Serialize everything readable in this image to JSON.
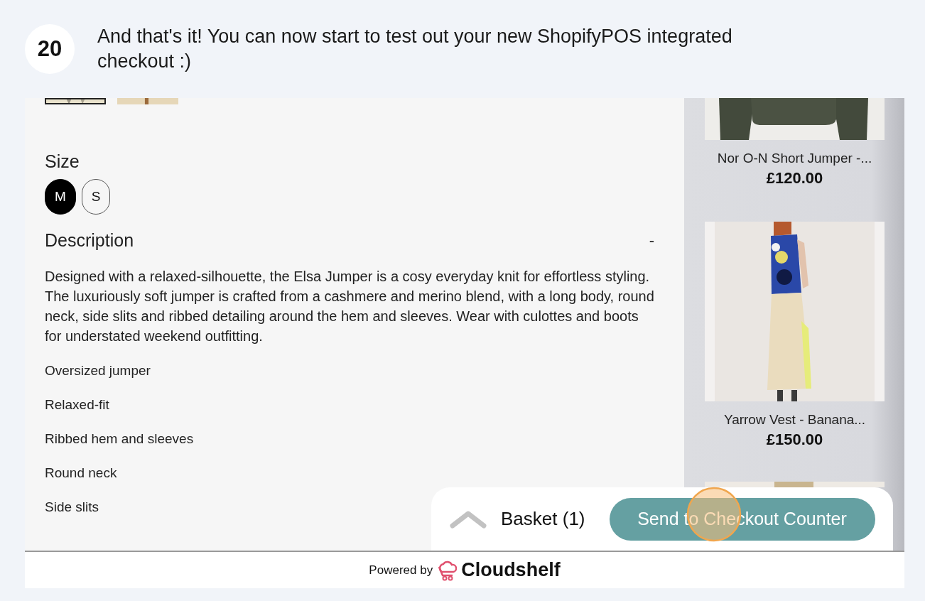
{
  "step": {
    "number": "20",
    "text": "And that's it! You can now start to test out your new ShopifyPOS integrated checkout :)"
  },
  "product": {
    "size_label": "Size",
    "sizes": [
      {
        "label": "M",
        "selected": true
      },
      {
        "label": "S",
        "selected": false
      }
    ],
    "description_title": "Description",
    "description_toggle": "-",
    "description": "Designed with a relaxed-silhouette, the Elsa Jumper is a cosy everyday knit for effortless styling. The luxuriously soft jumper is crafted from a cashmere and merino blend, with a long body, round neck, side slits and ribbed detailing around the hem and sleeves. Wear with culottes and boots for understated weekend outfitting.",
    "features": [
      "Oversized jumper",
      "Relaxed-fit",
      "Ribbed hem and sleeves",
      "Round neck",
      "Side slits"
    ]
  },
  "related": [
    {
      "name": "Nor O-N Short Jumper -...",
      "price": "£120.00"
    },
    {
      "name": "Yarrow Vest - Banana...",
      "price": "£150.00"
    }
  ],
  "basket": {
    "label": "Basket",
    "count": "(1)",
    "button": "Send to Checkout Counter"
  },
  "footer": {
    "powered_by": "Powered by",
    "brand": "Cloudshelf"
  }
}
